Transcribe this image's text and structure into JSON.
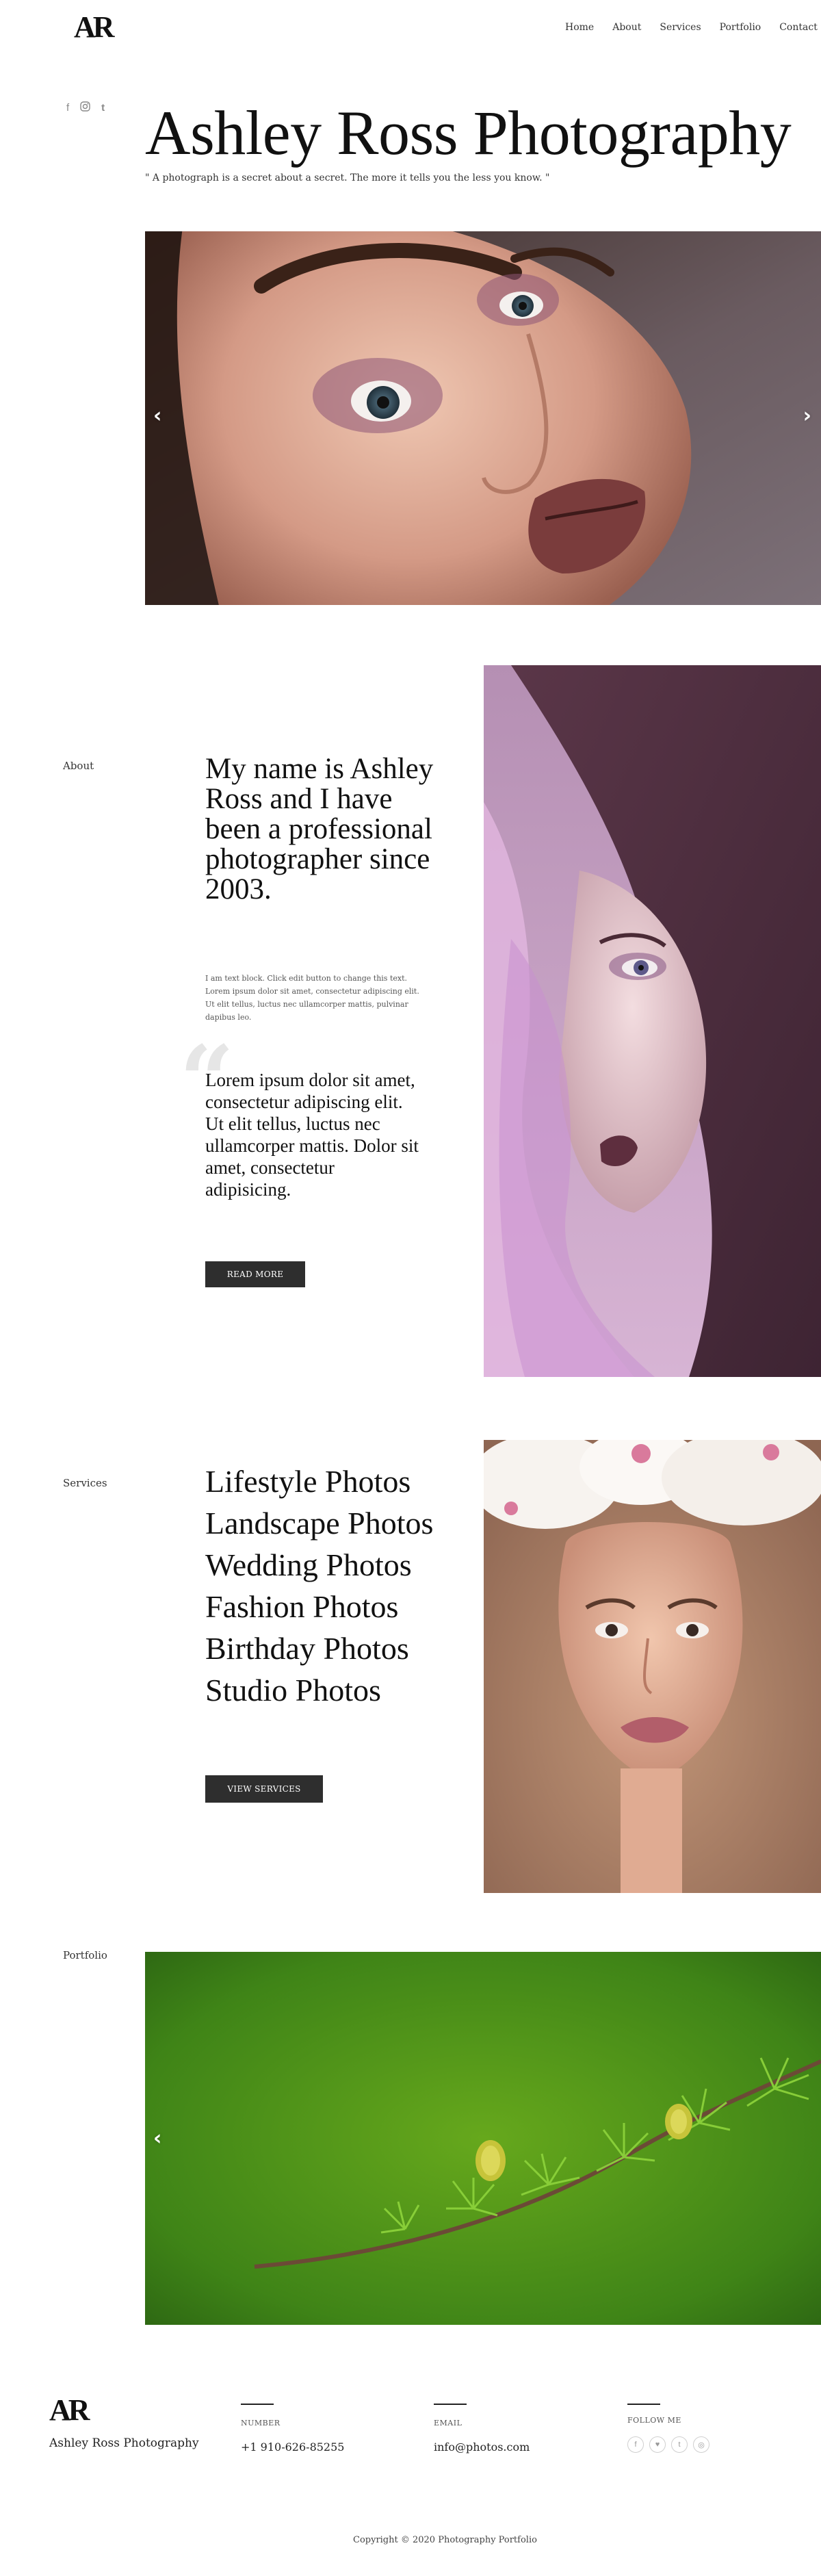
{
  "header": {
    "logo": "AR",
    "nav": [
      "Home",
      "About",
      "Services",
      "Portfolio",
      "Contact"
    ]
  },
  "hero": {
    "social_icons": [
      "facebook-icon",
      "instagram-icon",
      "tumblr-icon"
    ],
    "title": "Ashley Ross Photography",
    "quote": "\" A photograph is a secret about a secret. The more it tells you the less you know. \"",
    "slider_prev": "‹",
    "slider_next": "›"
  },
  "about": {
    "label": "About",
    "heading": "My name is Ashley Ross and I have been a professional photographer since 2003.",
    "body": "I am text block. Click edit button to change this text. Lorem ipsum dolor sit amet, consectetur adipiscing elit. Ut elit tellus, luctus nec ullamcorper mattis, pulvinar dapibus leo.",
    "quote_mark": "“",
    "quote": "Lorem ipsum dolor sit amet, consectetur adipiscing elit. Ut elit tellus, luctus nec ullamcorper mattis. Dolor sit amet, consectetur adipisicing.",
    "button": "READ MORE"
  },
  "services": {
    "label": "Services",
    "items": [
      "Lifestyle Photos",
      "Landscape Photos",
      "Wedding Photos",
      "Fashion Photos",
      "Birthday Photos",
      "Studio Photos"
    ],
    "button": "VIEW SERVICES"
  },
  "portfolio": {
    "label": "Portfolio",
    "slider_prev": "‹"
  },
  "footer": {
    "logo": "AR",
    "name": "Ashley Ross Photography",
    "number_label": "NUMBER",
    "number": "+1 910-626-85255",
    "email_label": "EMAIL",
    "email": "info@photos.com",
    "follow_label": "FOLLOW ME",
    "follow_icons": [
      "f",
      "♥",
      "t",
      "◎"
    ],
    "copyright": "Copyright © 2020 Photography Portfolio"
  },
  "colors": {
    "button_dark": "#2e2e2e",
    "text_dark": "#111111"
  }
}
